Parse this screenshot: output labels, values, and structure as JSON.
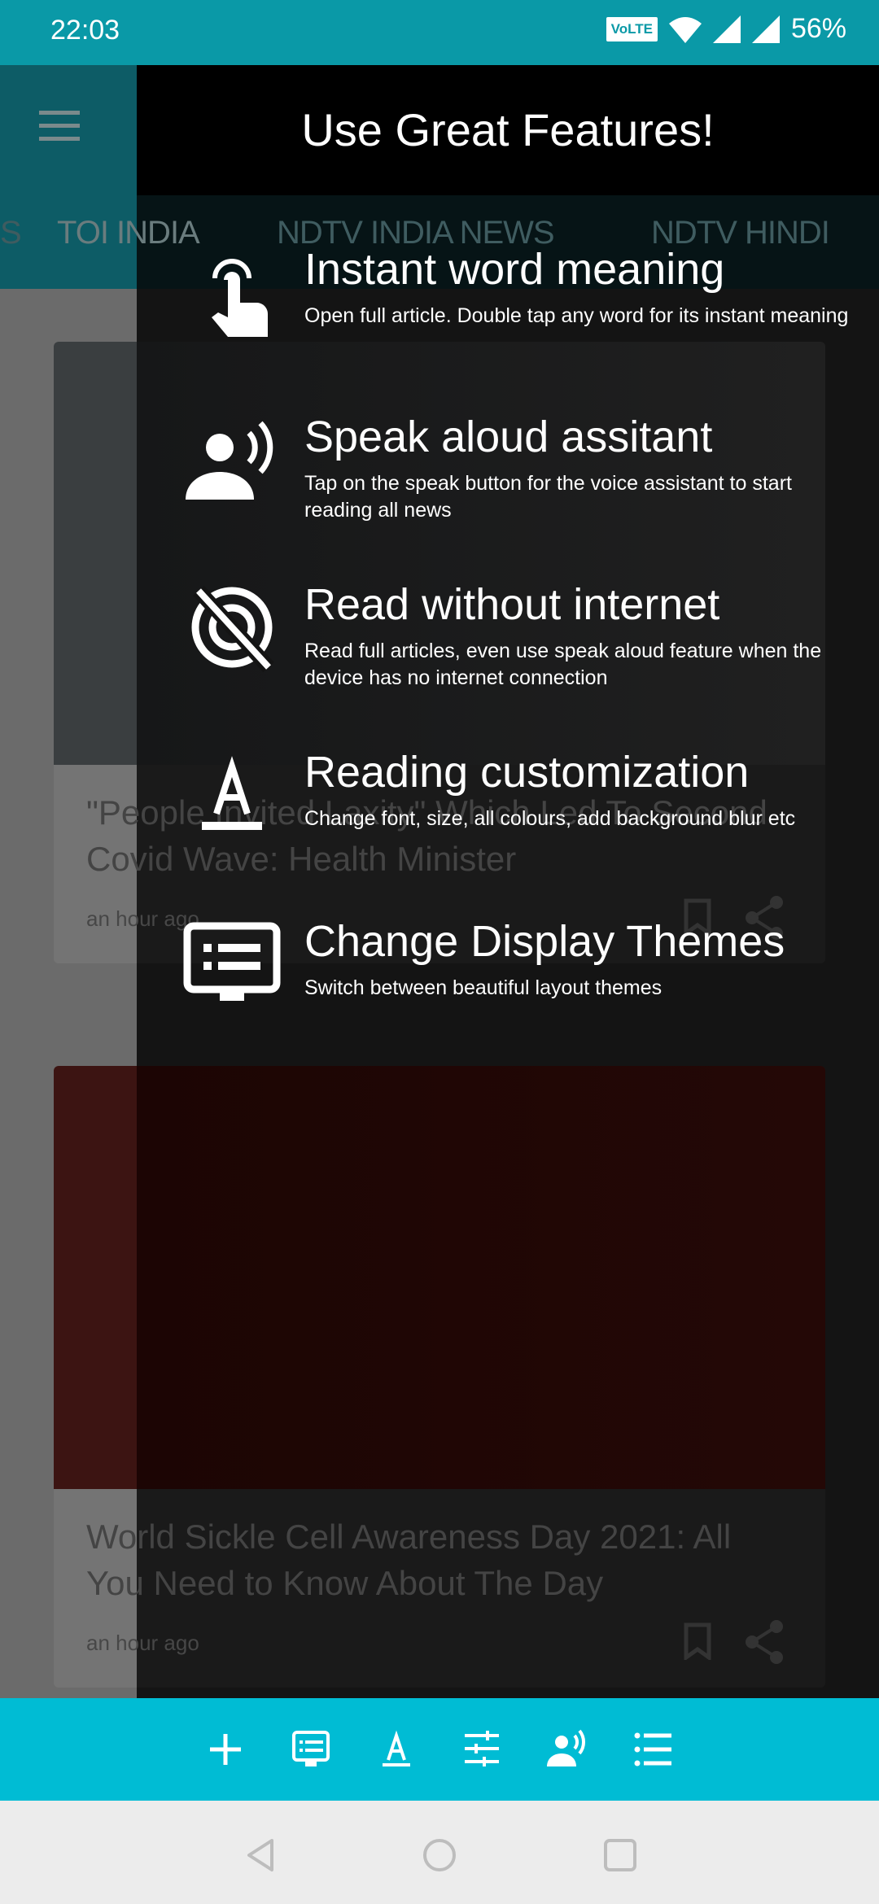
{
  "status_bar": {
    "time": "22:03",
    "volte": "VoLTE",
    "battery": "56%"
  },
  "app_bar": {
    "tabs": [
      "S",
      "TOI INDIA",
      "NDTV INDIA NEWS",
      "NDTV HINDI"
    ]
  },
  "cards": [
    {
      "title": "\"People Invited Laxity\" Which Led To Second Covid Wave: Health Minister",
      "time": "an hour ago"
    },
    {
      "title": "World Sickle Cell Awareness Day 2021: All You Need to Know About The Day",
      "time": "an hour ago"
    }
  ],
  "overlay": {
    "title": "Use Great Features!",
    "features": [
      {
        "icon": "touch-icon",
        "title": "Instant word meaning",
        "desc": "Open full article. Double tap any word for its instant meaning"
      },
      {
        "icon": "record-voice-icon",
        "title": "Speak aloud assitant",
        "desc": "Tap on the speak button for the voice assistant to start reading all news"
      },
      {
        "icon": "wifi-off-icon",
        "title": "Read without internet",
        "desc": "Read full articles, even use speak aloud feature when the device has no internet connection"
      },
      {
        "icon": "text-format-icon",
        "title": "Reading customization",
        "desc": "Change font, size, all colours, add background blur etc"
      },
      {
        "icon": "display-theme-icon",
        "title": "Change Display Themes",
        "desc": "Switch between beautiful layout themes"
      }
    ]
  },
  "bottom_bar": {
    "icons": [
      "add-icon",
      "display-theme-icon",
      "text-format-icon",
      "tune-icon",
      "record-voice-icon",
      "list-icon"
    ]
  },
  "colors": {
    "status": "#0a99a7",
    "accent": "#00bcd4",
    "navbar": "#ececec"
  }
}
